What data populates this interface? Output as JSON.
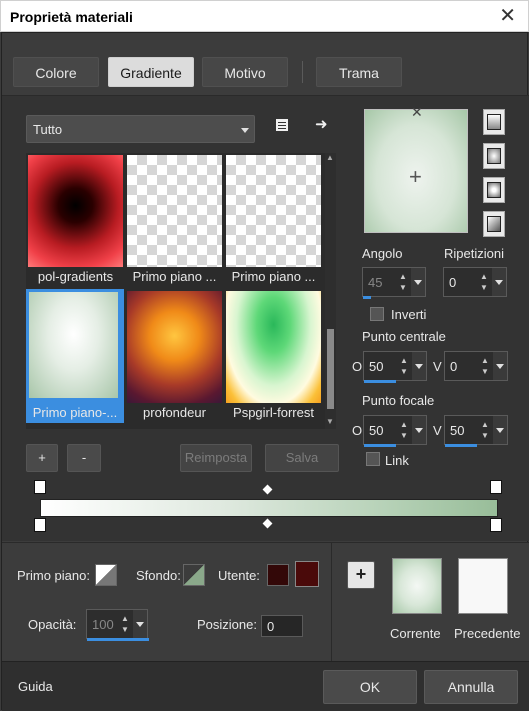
{
  "window": {
    "title": "Proprietà materiali",
    "close_glyph": "✕"
  },
  "tabs": [
    {
      "label": "Colore",
      "active": false
    },
    {
      "label": "Gradiente",
      "active": true
    },
    {
      "label": "Motivo",
      "active": false
    },
    {
      "label": "Trama",
      "active": false
    }
  ],
  "category": {
    "selected": "Tutto"
  },
  "gallery": {
    "items": [
      {
        "caption": "pol-gradients"
      },
      {
        "caption": "Primo piano ..."
      },
      {
        "caption": "Primo piano ..."
      },
      {
        "caption": "Primo piano-..."
      },
      {
        "caption": "profondeur"
      },
      {
        "caption": "Pspgirl-forrest"
      }
    ],
    "selected_index": 3
  },
  "gallery_buttons": {
    "add": "+",
    "remove": "-",
    "reset": "Reimposta",
    "save": "Salva"
  },
  "angle": {
    "label": "Angolo",
    "value": "45"
  },
  "repeats": {
    "label": "Ripetizioni",
    "value": "0"
  },
  "invert": {
    "label": "Inverti",
    "checked": false
  },
  "center": {
    "label": "Punto centrale",
    "h_label": "O",
    "h_value": "50",
    "v_label": "V",
    "v_value": "0"
  },
  "focal": {
    "label": "Punto focale",
    "h_label": "O",
    "h_value": "50",
    "v_label": "V",
    "v_value": "50"
  },
  "link": {
    "label": "Link",
    "checked": false
  },
  "stops": {
    "foreground_label": "Primo piano:",
    "background_label": "Sfondo:",
    "user_label": "Utente:",
    "user_color": "#4a0a0a",
    "opacity_label": "Opacità:",
    "opacity_value": "100",
    "position_label": "Posizione:",
    "position_value": "0"
  },
  "compare": {
    "add": "+",
    "current": "Corrente",
    "previous": "Precedente"
  },
  "footer": {
    "help": "Guida",
    "ok": "OK",
    "cancel": "Annulla"
  },
  "colors": {
    "accent": "#3b8ee0",
    "gradient_start": "#ffffff",
    "gradient_end": "#98bd99"
  }
}
